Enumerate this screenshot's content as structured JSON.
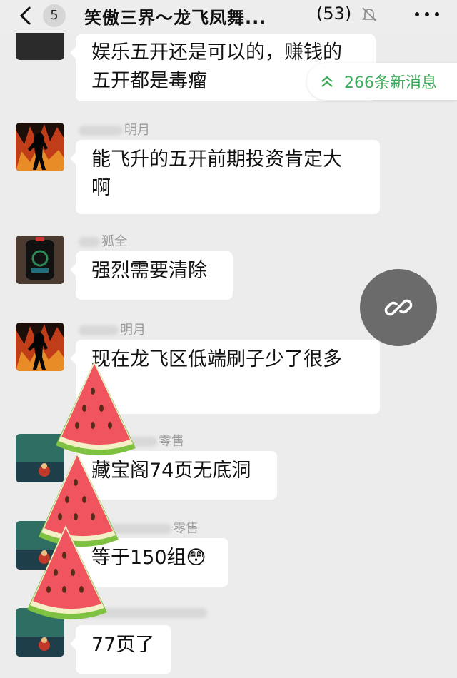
{
  "header": {
    "back_label": "",
    "unread_count": "5",
    "title": "笑傲三界～龙飞凤舞...",
    "member_count": "(53)"
  },
  "new_messages": {
    "label": "266条新消息"
  },
  "messages": [
    {
      "sender": "",
      "lines": [
        "娱乐五开还是可以的，赚钱的",
        "五开都是毒瘤"
      ]
    },
    {
      "sender": "明月",
      "lines": [
        "能飞升的五开前期投资肯定大",
        "啊"
      ]
    },
    {
      "sender": "狐全",
      "lines": [
        "强烈需要清除"
      ]
    },
    {
      "sender": "明月",
      "lines": [
        "现在龙飞区低端刷子少了很多",
        ""
      ]
    },
    {
      "sender": "零售",
      "lines": [
        "藏宝阁74页无底洞"
      ]
    },
    {
      "sender": "零售",
      "lines": [
        "等于150组😳"
      ]
    },
    {
      "sender": "",
      "lines": [
        "77页了"
      ]
    }
  ],
  "colors": {
    "accent_green": "#3daa59",
    "background": "#ececec",
    "bubble": "#ffffff"
  }
}
